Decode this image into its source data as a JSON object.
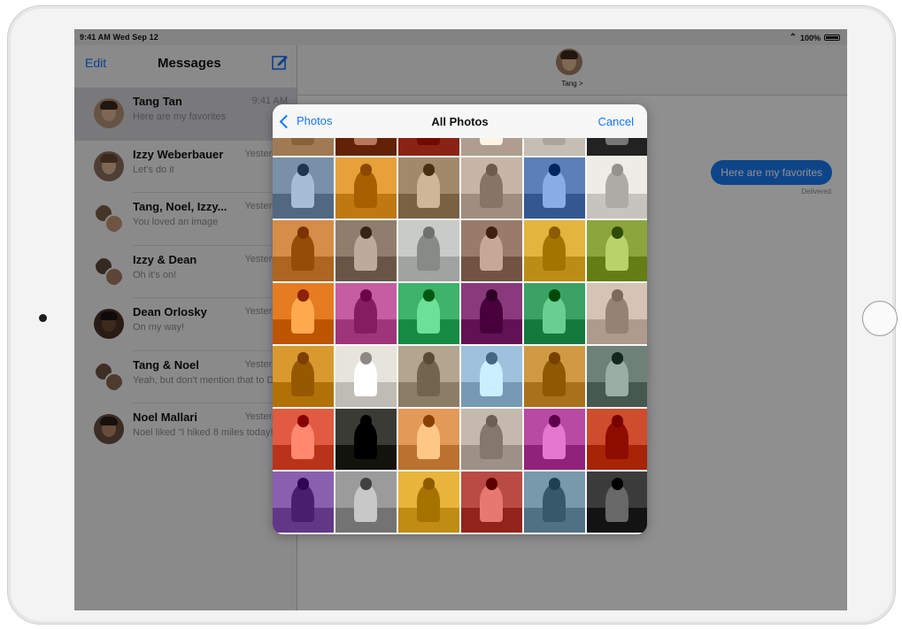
{
  "status_bar": {
    "time_date": "9:41 AM  Wed Sep 12",
    "battery": "100%"
  },
  "sidebar": {
    "edit_label": "Edit",
    "title": "Messages",
    "conversations": [
      {
        "name": "Tang Tan",
        "time": "9:41 AM",
        "preview": "Here are my favorites",
        "selected": true
      },
      {
        "name": "Izzy Weberbauer",
        "time": "Yesterday",
        "preview": "Let's do it"
      },
      {
        "name": "Tang, Noel, Izzy...",
        "time": "Yesterday",
        "preview": "You loved an image"
      },
      {
        "name": "Izzy & Dean",
        "time": "Yesterday",
        "preview": "Oh it's on!"
      },
      {
        "name": "Dean Orlosky",
        "time": "Yesterday",
        "preview": "On my way!"
      },
      {
        "name": "Tang & Noel",
        "time": "Yesterday",
        "preview": "Yeah, but don't mention that to Dean"
      },
      {
        "name": "Noel Mallari",
        "time": "Yesterday",
        "preview": "Noel liked \"I hiked 8 miles today!\""
      }
    ]
  },
  "chat": {
    "contact": "Tang >",
    "bubble": "Here are my favorites",
    "delivered": "Delivered"
  },
  "picker": {
    "back_label": "Photos",
    "title": "All Photos",
    "cancel_label": "Cancel"
  },
  "colors": {
    "accent": "#1476f6",
    "bubble": "#1a7cf5"
  },
  "photos": [
    [
      "#c8a27a",
      "#8b4a2e",
      "#b24b3c",
      "#d7c6b5",
      "#ece6dc",
      "#4a4a4a"
    ],
    [
      "#7a8fa8",
      "#e7a13a",
      "#a2896c",
      "#c8b5a6",
      "#5b7fb9",
      "#efebe6"
    ],
    [
      "#d58d47",
      "#8f7e6d",
      "#c9cbc6",
      "#9a7b6a",
      "#e4b53d",
      "#8aa63c"
    ],
    [
      "#e57c22",
      "#c65da1",
      "#3eb36a",
      "#883a7d",
      "#3aa264",
      "#d6c3b6"
    ],
    [
      "#d89a2f",
      "#e7e4dd",
      "#b3a590",
      "#9ec2dc",
      "#d09a44",
      "#6e8178"
    ],
    [
      "#e05b42",
      "#3b3b35",
      "#e39a58",
      "#c5b9ad",
      "#b84aa4",
      "#cf4c2d"
    ],
    [
      "#8a5fb0",
      "#9b9b9b",
      "#e8b43c",
      "#b94b42",
      "#7898ac",
      "#3b3b3b"
    ]
  ]
}
